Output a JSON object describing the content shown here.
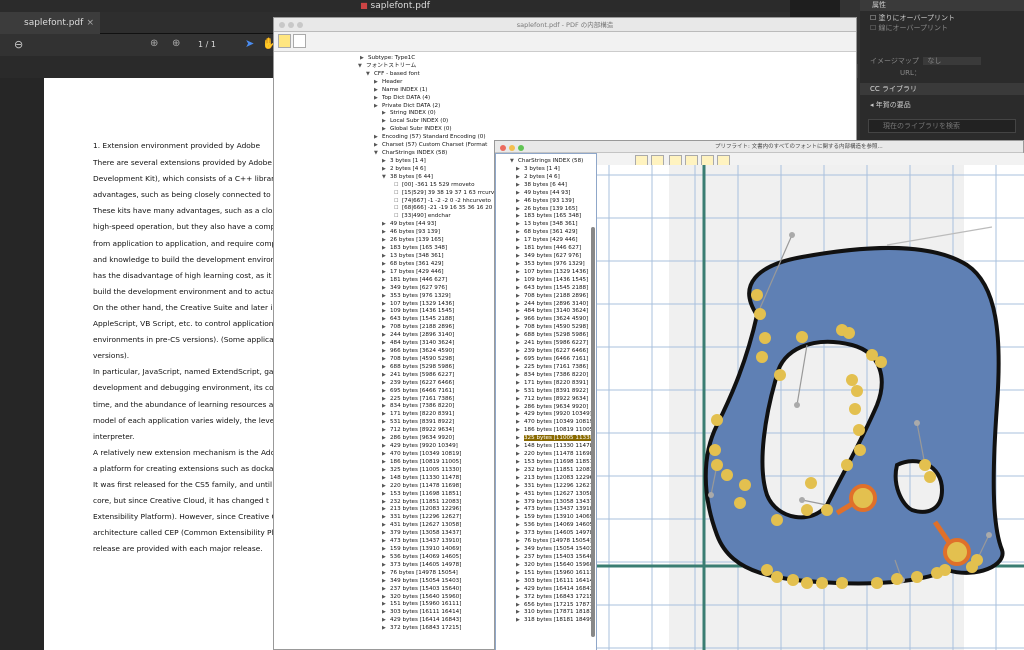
{
  "pdf_viewer": {
    "title": "saplefont.pdf",
    "tab": "saplefont.pdf",
    "page_indicator": "1 / 1",
    "lines": [
      "1. Extension environment provided by Adobe",
      "There are several extensions provided by Adobe fo",
      "Development Kit), which consists of a C++ library",
      "advantages, such as being closely connected to the",
      "These kits have many advantages, such as a close",
      "high-speed operation, but they also have a complex",
      "from application to application, and require compili",
      "and knowledge to build the development environme",
      "has the disadvantage of high learning cost, as it rec",
      "build the development environment and to actually d",
      "On the other hand, the Creative Suite and later intr",
      "AppleScript, VB Script, etc. to control application obj",
      "environments in pre-CS versions). (Some application",
      "versions).",
      "In particular, JavaScript, named ExtendScript, gai",
      "development and debugging environment, its confo",
      "time, and the abundance of learning resources avail",
      "model of each application varies widely, the level of",
      "interpreter.",
      "A relatively new extension mechanism is the Adobe",
      "a platform for creating extensions such as dockable",
      "It was first released for the CS5 family, and until CS",
      "core, but since Creative Cloud, it has changed t",
      "Extensibility Platform). However, since Creative Cloud",
      "architecture called CEP (Common Extensibility Plat",
      "release are provided with each major release."
    ]
  },
  "right_panel": {
    "header": "属性",
    "chk1": "塗りにオーバープリント",
    "chk2": "線にオーバープリント",
    "imagemap_label": "イメージマップ",
    "imagemap_value": "なし",
    "url_label": "URL：",
    "cc_header": "CC ライブラリ",
    "lib_name": "年賀の要品",
    "search_placeholder": "現在のライブラリを検索"
  },
  "struct_window": {
    "title": "saplefont.pdf - PDF の内部構造",
    "lines": [
      "Subtype:  Type1C",
      "フォントストリーム",
      "CFF - based font",
      "Header",
      "Name INDEX (1)",
      "Top Dict DATA (4)",
      "Private Dict DATA (2)",
      "String INDEX (0)",
      "Local Subr INDEX (0)",
      "Global Subr INDEX (0)",
      "Encoding (57) Standard Encoding (0)",
      "Charset (57) Custom Charset (Format",
      "CharStrings INDEX (58)",
      "3 bytes [1 4]",
      "2 bytes [4 6]",
      "38 bytes [6 44]",
      "[00] -361 15 529 rmoveto",
      "[15|529]  39 38 19 37 1 63 rrcurve",
      "[74|667] -1 -2 -2 0 -2 hhcurveto",
      "[68|666] -21 -19 16 35 36 16 20",
      "[33|490] endchar",
      "49 bytes [44 93]",
      "46 bytes [93 139]",
      "26 bytes [139 165]",
      "183 bytes [165 348]",
      "13 bytes [348 361]",
      "68 bytes [361 429]",
      "17 bytes [429 446]",
      "181 bytes [446 627]",
      "349 bytes [627 976]",
      "353 bytes [976 1329]",
      "107 bytes [1329 1436]",
      "109 bytes [1436 1545]",
      "643 bytes [1545 2188]",
      "708 bytes [2188 2896]",
      "244 bytes [2896 3140]",
      "484 bytes [3140 3624]",
      "966 bytes [3624 4590]",
      "708 bytes [4590 5298]",
      "688 bytes [5298 5986]",
      "241 bytes [5986 6227]",
      "239 bytes [6227 6466]",
      "695 bytes [6466 7161]",
      "225 bytes [7161 7386]",
      "834 bytes [7386 8220]",
      "171 bytes [8220 8391]",
      "531 bytes [8391 8922]",
      "712 bytes [8922 9634]",
      "286 bytes [9634 9920]",
      "429 bytes [9920 10349]",
      "470 bytes [10349 10819]",
      "186 bytes [10819 11005]",
      "325 bytes [11005 11330]",
      "148 bytes [11330 11478]",
      "220 bytes [11478 11698]",
      "153 bytes [11698 11851]",
      "232 bytes [11851 12083]",
      "213 bytes [12083 12296]",
      "331 bytes [12296 12627]",
      "431 bytes [12627 13058]",
      "379 bytes [13058 13437]",
      "473 bytes [13437 13910]",
      "159 bytes [13910 14069]",
      "536 bytes [14069 14605]",
      "373 bytes [14605 14978]",
      "76 bytes [14978 15054]",
      "349 bytes [15054 15403]",
      "237 bytes [15403 15640]",
      "320 bytes [15640 15960]",
      "151 bytes [15960 16111]",
      "303 bytes [16111 16414]",
      "429 bytes [16414 16843]",
      "372 bytes [16843 17215]"
    ]
  },
  "preflight": {
    "title": "プリフライト: 文書内のすべてのフォントに関する内部構造を参照...",
    "lines": [
      "CharStrings INDEX (58)",
      "3 bytes [1 4]",
      "2 bytes [4 6]",
      "38 bytes [6 44]",
      "49 bytes [44 93]",
      "46 bytes [93 139]",
      "26 bytes [139 165]",
      "183 bytes [165 348]",
      "13 bytes [348 361]",
      "68 bytes [361 429]",
      "17 bytes [429 446]",
      "181 bytes [446 627]",
      "349 bytes [627 976]",
      "353 bytes [976 1329]",
      "107 bytes [1329 1436]",
      "109 bytes [1436 1545]",
      "643 bytes [1545 2188]",
      "708 bytes [2188 2896]",
      "244 bytes [2896 3140]",
      "484 bytes [3140 3624]",
      "966 bytes [3624 4590]",
      "708 bytes [4590 5298]",
      "688 bytes [5298 5986]",
      "241 bytes [5986 6227]",
      "239 bytes [6227 6466]",
      "695 bytes [6466 7161]",
      "225 bytes [7161 7386]",
      "834 bytes [7386 8220]",
      "171 bytes [8220 8391]",
      "531 bytes [8391 8922]",
      "712 bytes [8922 9634]",
      "286 bytes [9634 9920]",
      "429 bytes [9920 10349]",
      "470 bytes [10349 10819]",
      "186 bytes [10819 11005]",
      "325 bytes [11005 11330]",
      "148 bytes [11330 11478]",
      "220 bytes [11478 11698]",
      "153 bytes [11698 11851]",
      "232 bytes [11851 12083]",
      "213 bytes [12083 12296]",
      "331 bytes [12296 12627]",
      "431 bytes [12627 13058]",
      "379 bytes [13058 13437]",
      "473 bytes [13437 13910]",
      "159 bytes [13910 14069]",
      "536 bytes [14069 14605]",
      "373 bytes [14605 14978]",
      "76 bytes [14978 15054]",
      "349 bytes [15054 15403]",
      "237 bytes [15403 15640]",
      "320 bytes [15640 15960]",
      "151 bytes [15960 16111]",
      "303 bytes [16111 16414]",
      "429 bytes [16414 16843]",
      "372 bytes [16843 17215]",
      "656 bytes [17215 17871]",
      "310 bytes [17871 18181]",
      "318 bytes [18181 18499]"
    ],
    "selected_index": 35
  },
  "colors": {
    "glyph_fill": "#5f80b4",
    "point": "#e3c04f",
    "handle_active": "#e0702a",
    "grid": "#a9c0de",
    "baseline": "#3a7d72",
    "selected": "#8a6a00"
  }
}
